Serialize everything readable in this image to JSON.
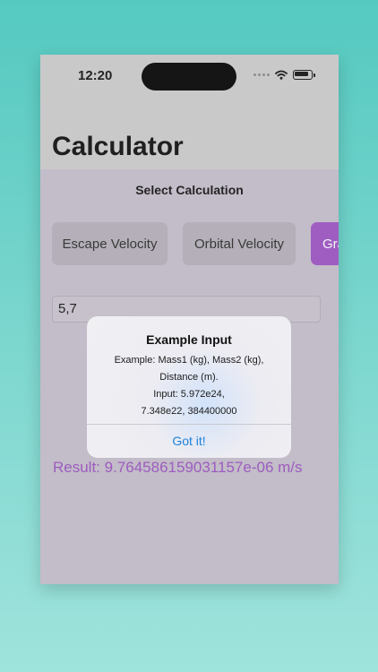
{
  "status": {
    "time": "12:20"
  },
  "nav": {
    "title": "Calculator"
  },
  "main": {
    "select_label": "Select Calculation",
    "segments": [
      "Escape Velocity",
      "Orbital Velocity",
      "Gra"
    ],
    "input_value": "5,7",
    "result": "Result: 9.764586159031157e-06 m/s"
  },
  "alert": {
    "title": "Example Input",
    "message_lines": [
      "Example: Mass1 (kg), Mass2 (kg),",
      "Distance (m).",
      "Input: 5.972e24,",
      "7.348e22, 384400000"
    ],
    "button": "Got it!"
  },
  "colors": {
    "accent": "#9e53c5",
    "link": "#1d82d9",
    "background_top": "#55c9c0",
    "background_bottom": "#9fe3dc"
  },
  "icons": [
    "cellular-dots-icon",
    "wifi-icon",
    "battery-icon"
  ]
}
